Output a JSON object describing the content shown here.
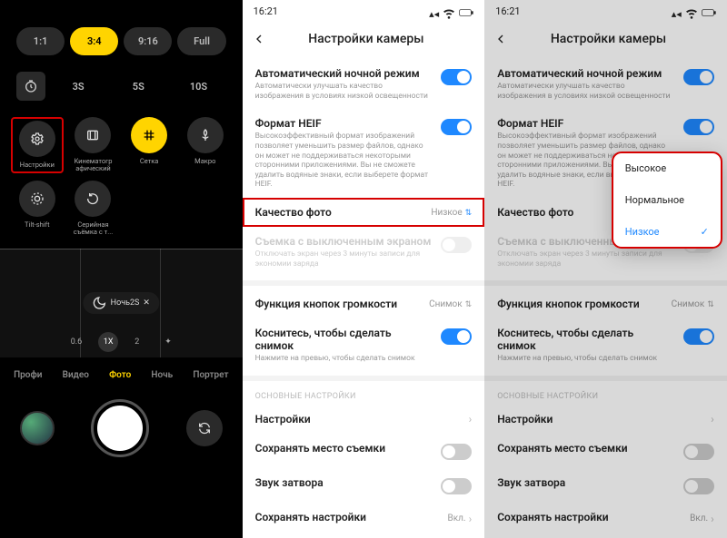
{
  "screen1": {
    "aspect_ratios": [
      "1:1",
      "3:4",
      "9:16",
      "Full"
    ],
    "timer_opts": [
      "3S",
      "5S",
      "10S"
    ],
    "tools": [
      {
        "label": "Настройки"
      },
      {
        "label": "Кинематогр афический"
      },
      {
        "label": "Сетка"
      },
      {
        "label": "Макро"
      },
      {
        "label": "Tilt-shift"
      },
      {
        "label": "Серийная съёмка с т..."
      }
    ],
    "mode_pill": "Ночь2S",
    "zoom": [
      "0.6",
      "1X",
      "2"
    ],
    "modes": [
      "Профи",
      "Видео",
      "Фото",
      "Ночь",
      "Портрет"
    ]
  },
  "status": {
    "time": "16:21"
  },
  "settings": {
    "title": "Настройки камеры",
    "auto_night": {
      "title": "Автоматический ночной режим",
      "sub": "Автоматически улучшать качество изображения в условиях низкой освещенности"
    },
    "heif": {
      "title": "Формат HEIF",
      "sub": "Высокоэффективный формат изображений позволяет уменьшить размер файлов, однако он может не поддерживаться некоторыми сторонними приложениями. Вы не сможете удалить водяные знаки, если выберете формат HEIF."
    },
    "quality": {
      "title": "Качество фото",
      "value": "Низкое"
    },
    "screen_off": {
      "title": "Съемка с выключенным экраном",
      "sub": "Отключать экран через 3 минуты записи для экономии заряда"
    },
    "vol": {
      "title": "Функция кнопок громкости",
      "value": "Снимок"
    },
    "tap": {
      "title": "Коснитесь, чтобы сделать снимок",
      "sub": "Нажмите на превью, чтобы сделать снимок"
    },
    "section": "ОСНОВНЫЕ НАСТРОЙКИ",
    "pref": "Настройки",
    "loc": "Сохранять место съемки",
    "shutter_sound": "Звук затвора",
    "save_settings": {
      "title": "Сохранять настройки",
      "value": "Вкл."
    }
  },
  "popup": {
    "options": [
      "Высокое",
      "Нормальное",
      "Низкое"
    ]
  }
}
